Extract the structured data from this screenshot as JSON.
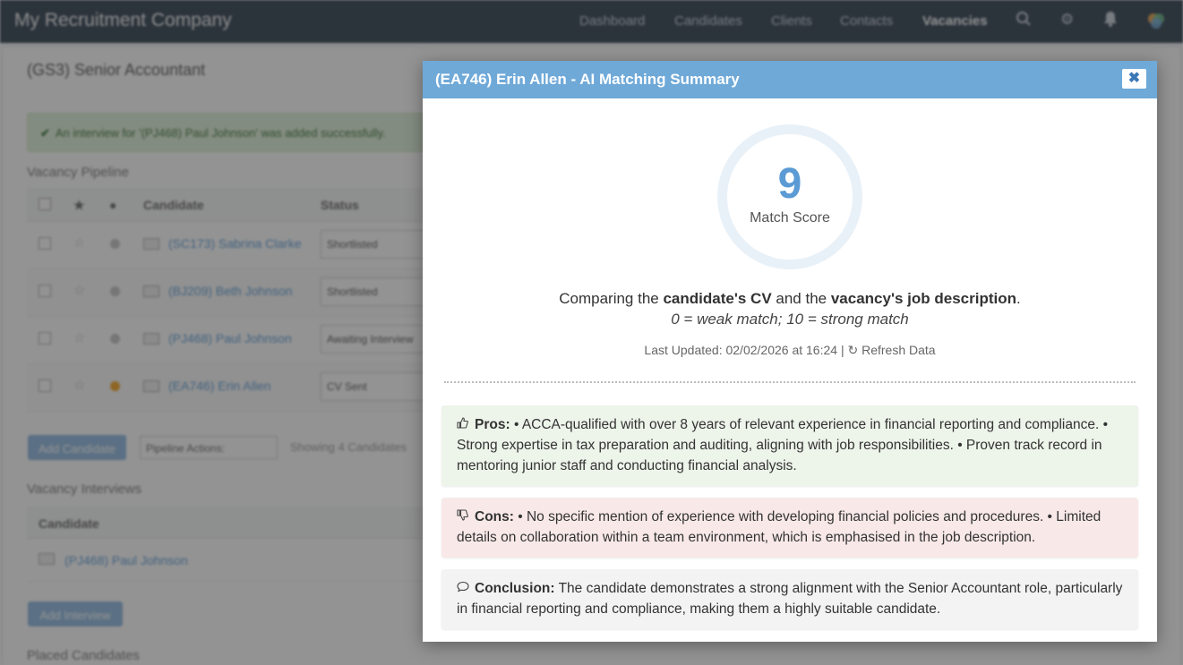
{
  "app": {
    "brand": "My Recruitment Company",
    "nav": [
      "Dashboard",
      "Candidates",
      "Clients",
      "Contacts",
      "Vacancies"
    ],
    "nav_active": "Vacancies",
    "nav_icons": [
      "search-icon",
      "gear-icon",
      "bell-icon",
      "user-avatar-icon"
    ]
  },
  "page": {
    "title": "(GS3) Senior Accountant",
    "alert": "An interview for '(PJ468) Paul Johnson' was added successfully.",
    "pipeline": {
      "title": "Vacancy Pipeline",
      "columns": [
        "Candidate",
        "Status"
      ],
      "rows": [
        {
          "name": "(SC173) Sabrina Clarke",
          "status": "Shortlisted",
          "dot": "grey"
        },
        {
          "name": "(BJ209) Beth Johnson",
          "status": "Shortlisted",
          "dot": "grey"
        },
        {
          "name": "(PJ468) Paul Johnson",
          "status": "Awaiting Interview",
          "dot": "grey"
        },
        {
          "name": "(EA746) Erin Allen",
          "status": "CV Sent",
          "dot": "orange"
        }
      ],
      "add_button": "Add Candidate",
      "actions_select": "Pipeline Actions:",
      "showing": "Showing 4 Candidates"
    },
    "interviews": {
      "title": "Vacancy Interviews",
      "column": "Candidate",
      "rows": [
        {
          "name": "(PJ468) Paul Johnson"
        }
      ],
      "add_button": "Add Interview"
    },
    "placed_title": "Placed Candidates"
  },
  "modal": {
    "title": "(EA746) Erin Allen - AI Matching Summary",
    "close_icon": "close-icon",
    "score": "9",
    "score_label": "Match Score",
    "compare": {
      "pre": "Comparing the ",
      "bold1": "candidate's CV",
      "mid": " and the ",
      "bold2": "vacancy's job description",
      "post": "."
    },
    "scale_note": "0 = weak match; 10 = strong match",
    "last_updated": "Last Updated: 02/02/2026 at 16:24",
    "separator": "|",
    "refresh_label": "Refresh Data",
    "pros": {
      "label": "Pros:",
      "text": "• ACCA-qualified with over 8 years of relevant experience in financial reporting and compliance. • Strong expertise in tax preparation and auditing, aligning with job responsibilities. • Proven track record in mentoring junior staff and conducting financial analysis."
    },
    "cons": {
      "label": "Cons:",
      "text": "• No specific mention of experience with developing financial policies and procedures. • Limited details on collaboration within a team environment, which is emphasised in the job description."
    },
    "conclusion": {
      "label": "Conclusion:",
      "text": "The candidate demonstrates a strong alignment with the Senior Accountant role, particularly in financial reporting and compliance, making them a highly suitable candidate."
    }
  },
  "colors": {
    "modal_header": "#6fa9d8",
    "score": "#5b9bd5",
    "pros_bg": "#edf4ea",
    "cons_bg": "#f8e9e8",
    "conclusion_bg": "#f3f3f3",
    "navbar": "#2f3f4f"
  }
}
